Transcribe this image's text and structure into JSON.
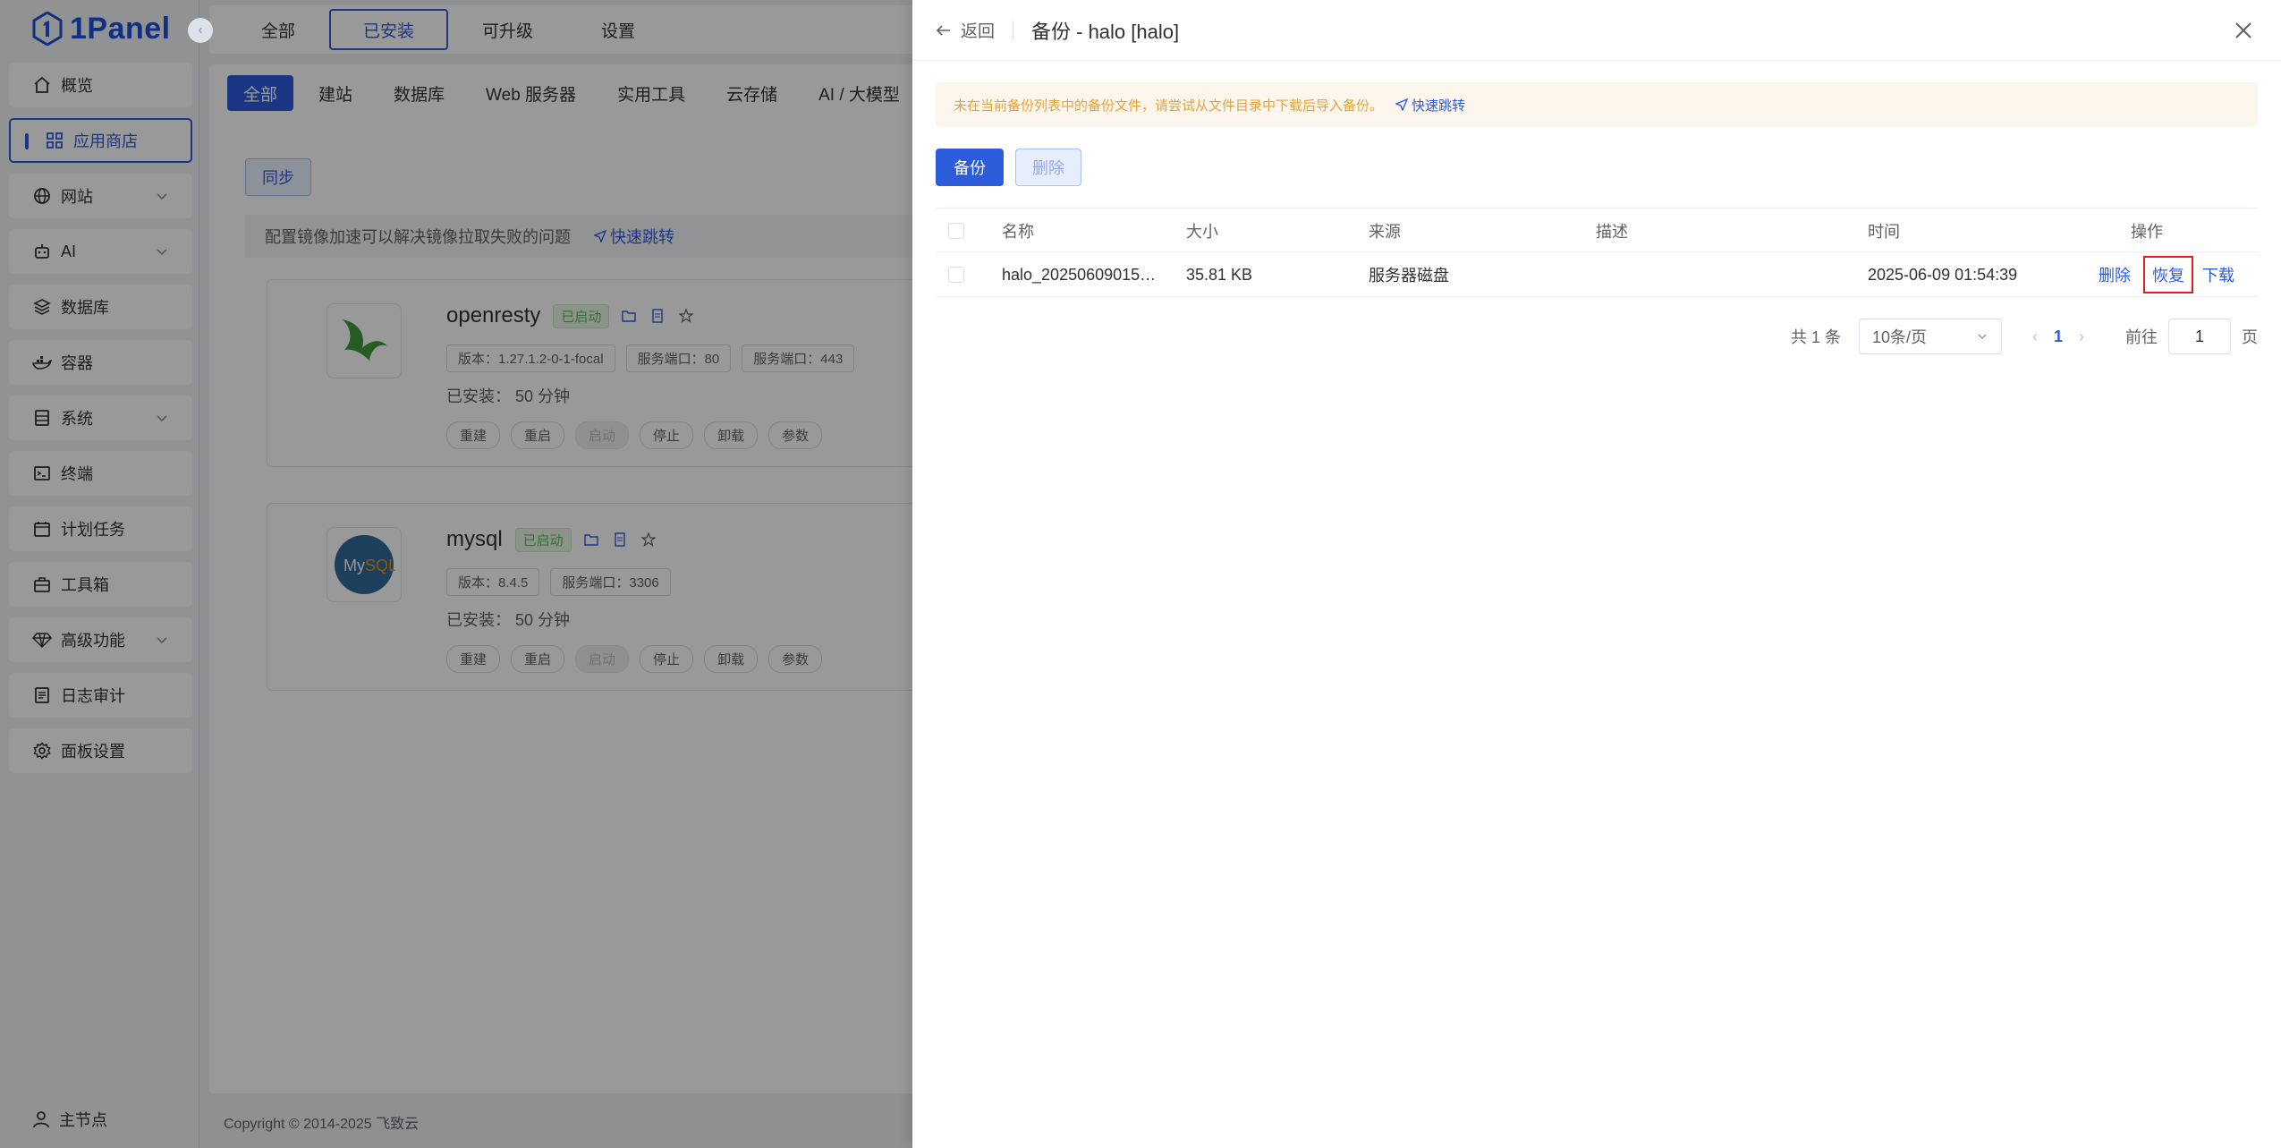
{
  "brand": {
    "name": "1Panel",
    "color": "#2d5cdb"
  },
  "sidebar": {
    "items": [
      {
        "label": "概览",
        "icon": "home-icon",
        "chevron": false,
        "active": false
      },
      {
        "label": "应用商店",
        "icon": "grid-icon",
        "chevron": false,
        "active": true
      },
      {
        "label": "网站",
        "icon": "globe-icon",
        "chevron": true,
        "active": false
      },
      {
        "label": "AI",
        "icon": "robot-icon",
        "chevron": true,
        "active": false
      },
      {
        "label": "数据库",
        "icon": "layers-icon",
        "chevron": false,
        "active": false
      },
      {
        "label": "容器",
        "icon": "docker-icon",
        "chevron": false,
        "active": false
      },
      {
        "label": "系统",
        "icon": "server-icon",
        "chevron": true,
        "active": false
      },
      {
        "label": "终端",
        "icon": "terminal-icon",
        "chevron": false,
        "active": false
      },
      {
        "label": "计划任务",
        "icon": "calendar-icon",
        "chevron": false,
        "active": false
      },
      {
        "label": "工具箱",
        "icon": "toolbox-icon",
        "chevron": false,
        "active": false
      },
      {
        "label": "高级功能",
        "icon": "diamond-icon",
        "chevron": true,
        "active": false
      },
      {
        "label": "日志审计",
        "icon": "log-icon",
        "chevron": false,
        "active": false
      },
      {
        "label": "面板设置",
        "icon": "gear-icon",
        "chevron": false,
        "active": false
      }
    ],
    "node_label": "主节点"
  },
  "topbar": {
    "tabs": [
      "全部",
      "已安装",
      "可升级",
      "设置"
    ],
    "active_index": 1
  },
  "categories": [
    "全部",
    "建站",
    "数据库",
    "Web 服务器",
    "实用工具",
    "云存储",
    "AI / 大模型"
  ],
  "sync_label": "同步",
  "mirror_notice": {
    "text": "配置镜像加速可以解决镜像拉取失败的问题",
    "link": "快速跳转"
  },
  "apps": [
    {
      "name": "openresty",
      "status": "已启动",
      "tags": [
        "版本：1.27.1.2-0-1-focal",
        "服务端口：80",
        "服务端口：443"
      ],
      "installed": "已安装： 50 分钟",
      "actions": [
        "重建",
        "重启",
        "启动",
        "停止",
        "卸载",
        "参数"
      ]
    },
    {
      "name": "mysql",
      "status": "已启动",
      "tags": [
        "版本：8.4.5",
        "服务端口：3306"
      ],
      "installed": "已安装： 50 分钟",
      "actions": [
        "重建",
        "重启",
        "启动",
        "停止",
        "卸载",
        "参数"
      ]
    }
  ],
  "copyright": "Copyright © 2014-2025 飞致云",
  "drawer": {
    "back_label": "返回",
    "title": "备份 - halo [halo]",
    "warning": {
      "text": "未在当前备份列表中的备份文件，请尝试从文件目录中下载后导入备份。",
      "link": "快速跳转"
    },
    "backup_button": "备份",
    "delete_button": "删除",
    "table": {
      "headers": [
        "名称",
        "大小",
        "来源",
        "描述",
        "时间",
        "操作"
      ],
      "rows": [
        {
          "name": "halo_20250609015…",
          "size": "35.81 KB",
          "source": "服务器磁盘",
          "description": "",
          "time": "2025-06-09 01:54:39",
          "ops": [
            "删除",
            "恢复",
            "下载"
          ]
        }
      ]
    },
    "pagination": {
      "total": "共 1 条",
      "page_size": "10条/页",
      "current_page": "1",
      "goto_label": "前往",
      "goto_value": "1",
      "page_suffix": "页"
    }
  }
}
